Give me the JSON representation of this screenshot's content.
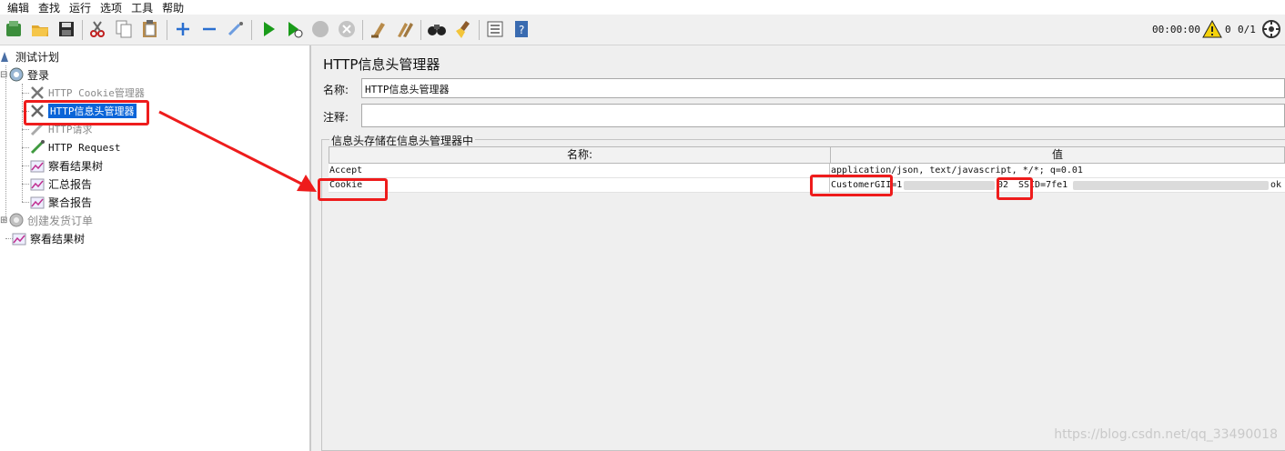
{
  "menu": [
    "编辑",
    "查找",
    "运行",
    "选项",
    "工具",
    "帮助"
  ],
  "toolbar": {
    "icons": [
      "templates-icon",
      "open-icon",
      "save-icon",
      "cut-icon",
      "copy-icon",
      "paste-icon",
      "expand-icon",
      "collapse-icon",
      "toggle-icon",
      "start-icon",
      "start-no-pause-icon",
      "stop-icon",
      "shutdown-icon",
      "clear-icon",
      "clear-all-icon",
      "search-icon",
      "reset-search-icon",
      "function-helper-icon",
      "help-icon"
    ],
    "timer": "00:00:00",
    "warning_count": "0",
    "threads": "0/1"
  },
  "tree": {
    "root": "测试计划",
    "group1": "登录",
    "cookie_manager": "HTTP Cookie管理器",
    "header_manager": "HTTP信息头管理器",
    "http_request_disabled": "HTTP请求",
    "http_request": "HTTP Request",
    "view_results_tree": "察看结果树",
    "summary_report": "汇总报告",
    "aggregate_report": "聚合报告",
    "group2": "创建发货订单",
    "view_results_tree_2": "察看结果树"
  },
  "panel": {
    "title": "HTTP信息头管理器",
    "name_label": "名称:",
    "name_value": "HTTP信息头管理器",
    "comment_label": "注释:",
    "comment_value": "",
    "group_label": "信息头存储在信息头管理器中",
    "table": {
      "headers": [
        "名称:",
        "值"
      ],
      "rows": [
        {
          "name": "Accept",
          "value": "application/json, text/javascript, */*; q=0.01"
        },
        {
          "name": "Cookie",
          "value_parts": [
            "CustomerGII=1",
            "02",
            "SSID=7fe1",
            "ok"
          ]
        }
      ]
    }
  },
  "watermark": "https://blog.csdn.net/qq_33490018",
  "colors": {
    "selection": "#0a64d8",
    "annotation": "#ee1c1c",
    "start_green": "#1a9b1a"
  }
}
